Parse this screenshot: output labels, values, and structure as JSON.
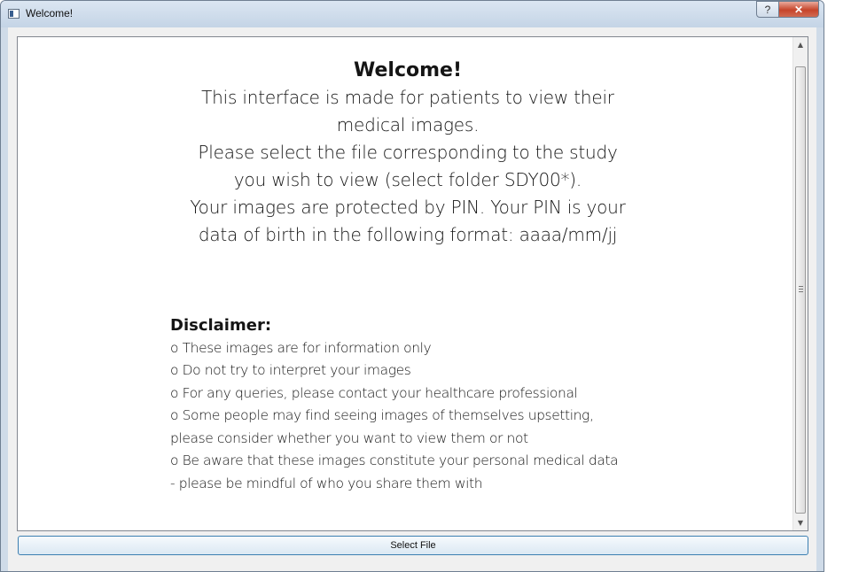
{
  "window": {
    "title": "Welcome!",
    "help_label": "?",
    "close_label": "✕"
  },
  "welcome": {
    "title": "Welcome!",
    "lines": [
      "This interface is made for patients to view their",
      "medical images.",
      "Please select the file corresponding to the study",
      "you wish to view (select folder SDY00*).",
      "Your images are protected by PIN. Your PIN is your",
      "data of birth in the following format: aaaa/mm/jj"
    ]
  },
  "disclaimer": {
    "title": "Disclaimer:",
    "lines": [
      "o These images are for information only",
      "o Do not try to interpret your images",
      "o For any queries, please contact your healthcare professional",
      "o Some people may find seeing images of themselves upsetting,",
      "please consider whether you want to view them or not",
      "o Be aware that these images constitute your personal medical data",
      "- please be mindful of who you share them with"
    ]
  },
  "scrollbar": {
    "up_icon": "▲",
    "down_icon": "▼"
  },
  "select_button": {
    "label": "Select File"
  }
}
